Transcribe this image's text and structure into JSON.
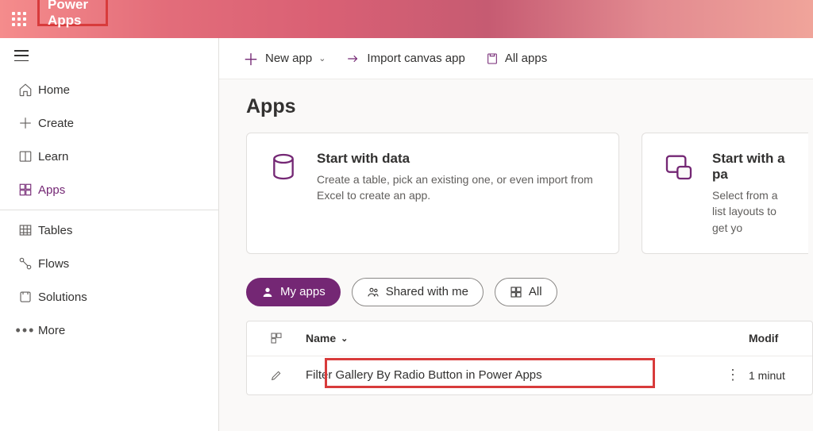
{
  "brand": "Power Apps",
  "sidebar": {
    "items": [
      {
        "label": "Home"
      },
      {
        "label": "Create"
      },
      {
        "label": "Learn"
      },
      {
        "label": "Apps"
      },
      {
        "label": "Tables"
      },
      {
        "label": "Flows"
      },
      {
        "label": "Solutions"
      },
      {
        "label": "More"
      }
    ]
  },
  "commandbar": {
    "newapp": "New app",
    "import": "Import canvas app",
    "allapps": "All apps"
  },
  "page": {
    "title": "Apps"
  },
  "cards": {
    "data": {
      "title": "Start with data",
      "desc": "Create a table, pick an existing one, or even import from Excel to create an app."
    },
    "page": {
      "title": "Start with a pa",
      "desc": "Select from a list layouts to get yo"
    }
  },
  "filters": {
    "my": "My apps",
    "shared": "Shared with me",
    "all": "All"
  },
  "grid": {
    "header_name": "Name",
    "header_modified": "Modif",
    "rows": [
      {
        "name": "Filter Gallery By Radio Button in Power Apps",
        "modified": "1 minut"
      }
    ]
  }
}
